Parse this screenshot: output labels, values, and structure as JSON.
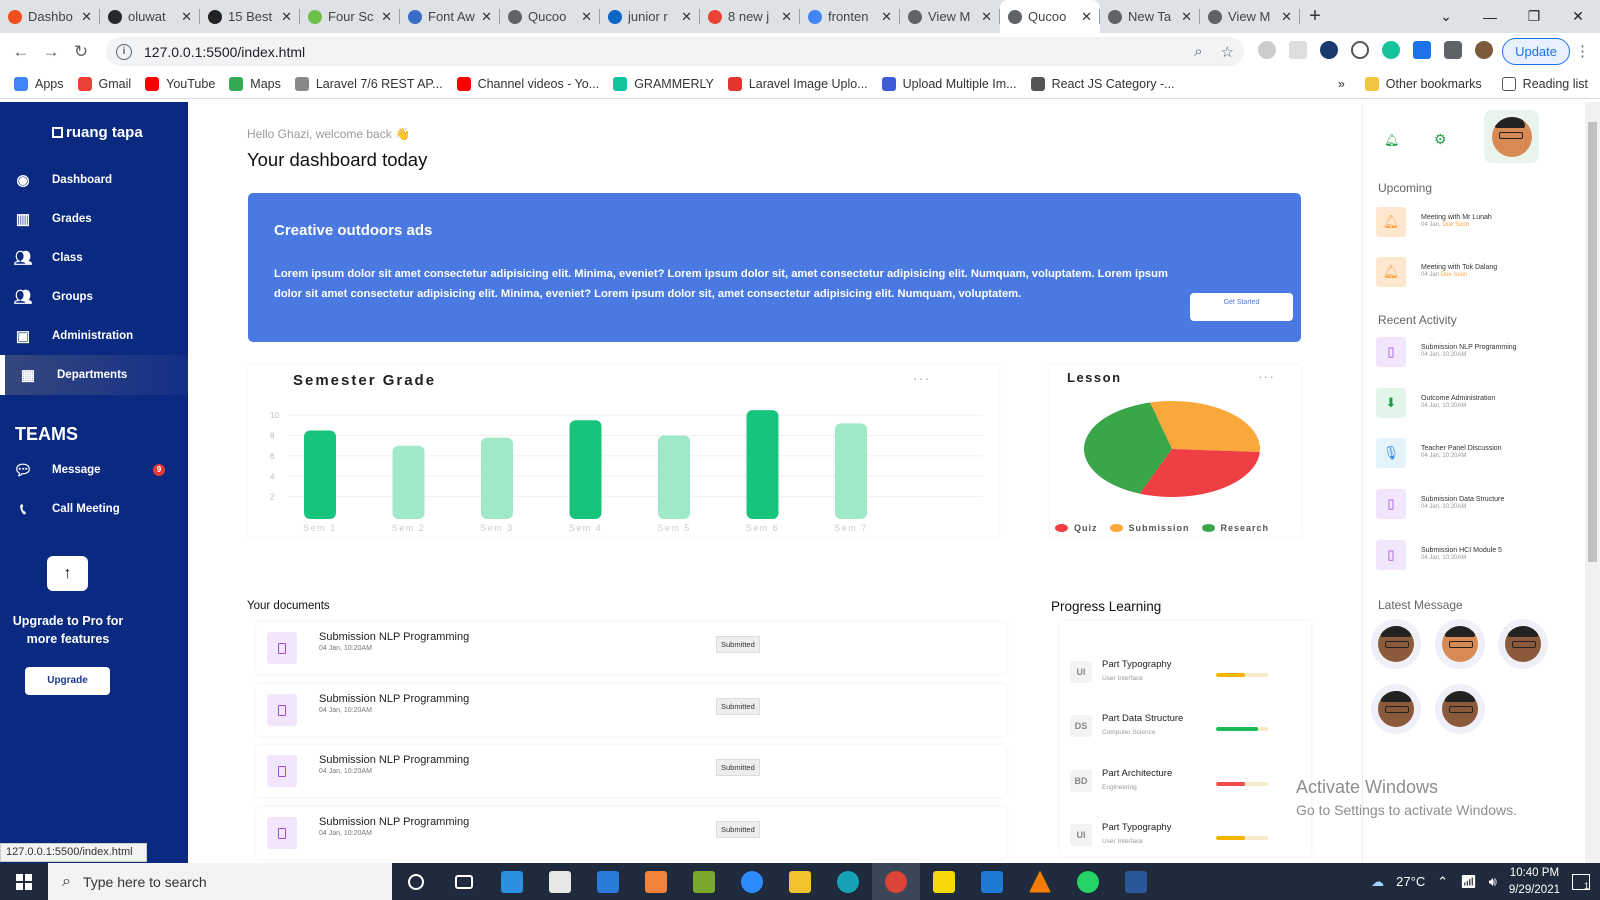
{
  "browser": {
    "tabs": [
      {
        "title": "Dashbo",
        "color": "#f24e1e",
        "active": false
      },
      {
        "title": "oluwat",
        "color": "#24292e",
        "active": false
      },
      {
        "title": "15 Best",
        "color": "#222222",
        "active": false
      },
      {
        "title": "Four Sc",
        "color": "#6cc04a",
        "active": false
      },
      {
        "title": "Font Aw",
        "color": "#3a6cc7",
        "active": false
      },
      {
        "title": "Qucoo",
        "color": "#5f6368",
        "active": false
      },
      {
        "title": "junior r",
        "color": "#0a66c2",
        "active": false
      },
      {
        "title": "8 new j",
        "color": "#ea4335",
        "active": false
      },
      {
        "title": "fronten",
        "color": "#4285f4",
        "active": false
      },
      {
        "title": "View M",
        "color": "#5f6368",
        "active": false
      },
      {
        "title": "Qucoo",
        "color": "#5f6368",
        "active": true
      },
      {
        "title": "New Ta",
        "color": "#5f6368",
        "active": false
      },
      {
        "title": "View M",
        "color": "#5f6368",
        "active": false
      }
    ],
    "url": "127.0.0.1:5500/index.html",
    "update_label": "Update",
    "bookmarks": [
      {
        "label": "Apps",
        "color": "#4285f4"
      },
      {
        "label": "Gmail",
        "color": "#ea4335"
      },
      {
        "label": "YouTube",
        "color": "#ff0000"
      },
      {
        "label": "Maps",
        "color": "#34a853"
      },
      {
        "label": "Laravel 7/6 REST AP...",
        "color": "#888888"
      },
      {
        "label": "Channel videos - Yo...",
        "color": "#ff0000"
      },
      {
        "label": "GRAMMERLY",
        "color": "#15c39a"
      },
      {
        "label": "Laravel Image Uplo...",
        "color": "#e3342f"
      },
      {
        "label": "Upload Multiple Im...",
        "color": "#3b5bdb"
      },
      {
        "label": "React JS Category -...",
        "color": "#555555"
      }
    ],
    "other_bookmarks": "Other bookmarks",
    "reading_list": "Reading list",
    "status_url": "127.0.0.1:5500/index.html"
  },
  "sidebar": {
    "logo": "ruang tapa",
    "nav": [
      {
        "label": "Dashboard",
        "icon": "dashboard-icon"
      },
      {
        "label": "Grades",
        "icon": "chart-icon"
      },
      {
        "label": "Class",
        "icon": "users-icon"
      },
      {
        "label": "Groups",
        "icon": "users-icon"
      },
      {
        "label": "Administration",
        "icon": "badge-icon"
      },
      {
        "label": "Departments",
        "icon": "building-icon"
      }
    ],
    "teams_title": "TEAMS",
    "teams": [
      {
        "label": "Message",
        "icon": "message-icon",
        "badge": "9"
      },
      {
        "label": "Call Meeting",
        "icon": "phone-icon",
        "badge": ""
      }
    ],
    "upgrade_arrow": "↑",
    "upgrade_text": "Upgrade to Pro for more features",
    "upgrade_button": "Upgrade"
  },
  "main": {
    "greeting": "Hello Ghazi, welcome back 👋",
    "title": "Your dashboard today",
    "banner": {
      "title": "Creative outdoors ads",
      "text": "Lorem ipsum dolor sit amet consectetur adipisicing elit. Minima, eveniet? Lorem ipsum dolor sit, amet consectetur adipisicing elit. Numquam, voluptatem. Lorem ipsum dolor sit amet consectetur adipisicing elit. Minima, eveniet? Lorem ipsum dolor sit, amet consectetur adipisicing elit. Numquam, voluptatem.",
      "button": "Get Started"
    },
    "documents_title": "Your documents",
    "documents": [
      {
        "title": "Submission NLP Programming",
        "date": "04 Jan, 10:20AM",
        "status": "Submitted"
      },
      {
        "title": "Submission NLP Programming",
        "date": "04 Jan, 10:20AM",
        "status": "Submitted"
      },
      {
        "title": "Submission NLP Programming",
        "date": "04 Jan, 10:20AM",
        "status": "Submitted"
      },
      {
        "title": "Submission NLP Programming",
        "date": "04 Jan, 10:20AM",
        "status": "Submitted"
      }
    ],
    "progress_title": "Progress Learning",
    "progress": [
      {
        "tag": "UI",
        "name": "Part Typography",
        "sub": "User Interface",
        "value": 0.55,
        "color": "#f4b400"
      },
      {
        "tag": "DS",
        "name": "Part Data Structure",
        "sub": "Computer Science",
        "value": 0.8,
        "color": "#1db954"
      },
      {
        "tag": "BD",
        "name": "Part Architecture",
        "sub": "Engineering",
        "value": 0.55,
        "color": "#f04d4d"
      },
      {
        "tag": "UI",
        "name": "Part Typography",
        "sub": "User Interface",
        "value": 0.55,
        "color": "#f4b400"
      }
    ],
    "dots": "···"
  },
  "chart_data": [
    {
      "type": "bar",
      "title": "Semester Grade",
      "categories": [
        "Sem 1",
        "Sem 2",
        "Sem 3",
        "Sem 4",
        "Sem 5",
        "Sem 6",
        "Sem 7"
      ],
      "values": [
        8.5,
        7,
        7.8,
        9.5,
        8,
        10.5,
        9.2
      ],
      "ylim": [
        0,
        11
      ],
      "yticks": [
        "10",
        "8",
        "6",
        "4",
        "2"
      ],
      "colors": [
        "#17c47b",
        "#9fe8c8",
        "#9fe8c8",
        "#17c47b",
        "#9fe8c8",
        "#17c47b",
        "#9fe8c8"
      ],
      "grid": true
    },
    {
      "type": "pie",
      "title": "Lesson",
      "categories": [
        "Quiz",
        "Submission",
        "Research"
      ],
      "values": [
        30,
        30,
        40
      ],
      "colors": [
        "#f03e45",
        "#f9a93a",
        "#3ba54a"
      ],
      "legend": "bottom"
    }
  ],
  "right": {
    "upcoming_title": "Upcoming",
    "upcoming": [
      {
        "title": "Meeting with Mr Lunah",
        "date": "04 Jan,",
        "due": "Due Soon"
      },
      {
        "title": "Meeting with Tok Dalang",
        "date": "04 Jan",
        "due": "Due Soon"
      }
    ],
    "activity_title": "Recent Activity",
    "activity": [
      {
        "title": "Submission NLP Programming",
        "date": "04 Jan, 10:20AM",
        "icon": "file-icon",
        "bg": "#f1e6fb",
        "fg": "#a04ad8"
      },
      {
        "title": "Outcome Administration",
        "date": "04 Jan, 10:20AM",
        "icon": "download-icon",
        "bg": "#e1f6e8",
        "fg": "#1e9e4a"
      },
      {
        "title": "Teacher Panel Discussion",
        "date": "04 Jan, 10:20AM",
        "icon": "mic-icon",
        "bg": "#e3f2fb",
        "fg": "#3a8ee6"
      },
      {
        "title": "Submission Data Structure",
        "date": "04 Jan, 10:20AM",
        "icon": "file-icon",
        "bg": "#f1e6fb",
        "fg": "#a04ad8"
      },
      {
        "title": "Submission HCI Module 5",
        "date": "04 Jan, 10:20AM",
        "icon": "file-icon",
        "bg": "#f1e6fb",
        "fg": "#a04ad8"
      }
    ],
    "messages_title": "Latest Message"
  },
  "windows": {
    "activate_title": "Activate Windows",
    "activate_sub": "Go to Settings to activate Windows.",
    "search_placeholder": "Type here to search",
    "temperature": "27°C",
    "time": "10:40 PM",
    "date": "9/29/2021",
    "notif_count": "1"
  }
}
